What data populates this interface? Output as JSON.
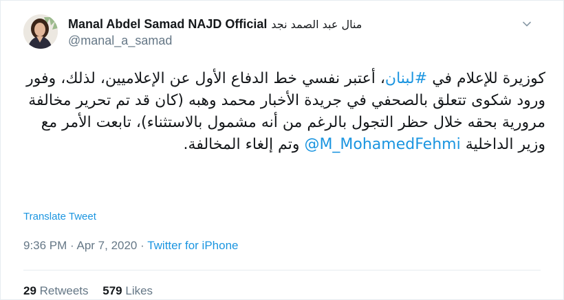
{
  "author": {
    "name_en": "Manal Abdel Samad NAJD Official",
    "name_ar": "منال عبد الصمد نجد",
    "handle": "@manal_a_samad",
    "avatar": "profile-photo"
  },
  "menu_icon": "chevron-down-icon",
  "tweet": {
    "text_part1": "كوزيرة للإعلام في ",
    "hashtag": "#لبنان",
    "text_part2": "، أعتبر نفسي خط الدفاع الأول عن الإعلاميين، لذلك، وفور ورود شكوى تتعلق بالصحفي في جريدة الأخبار محمد وهبه (كان قد تم تحرير مخالفة مرورية بحقه خلال حظر التجول بالرغم من أنه مشمول بالاستثناء)، تابعت الأمر مع وزير الداخلية ",
    "mention": "@M_MohamedFehmi",
    "text_part3": " وتم إلغاء المخالفة."
  },
  "translate_label": "Translate Tweet",
  "meta": {
    "time": "9:36 PM",
    "separator1": " · ",
    "date": "Apr 7, 2020",
    "separator2": " · ",
    "source": "Twitter for iPhone"
  },
  "stats": {
    "retweets_count": "29",
    "retweets_label": "Retweets",
    "likes_count": "579",
    "likes_label": "Likes"
  },
  "colors": {
    "link": "#1b95e0",
    "text": "#14171a",
    "secondary": "#657786",
    "border": "#e6ecf0"
  }
}
